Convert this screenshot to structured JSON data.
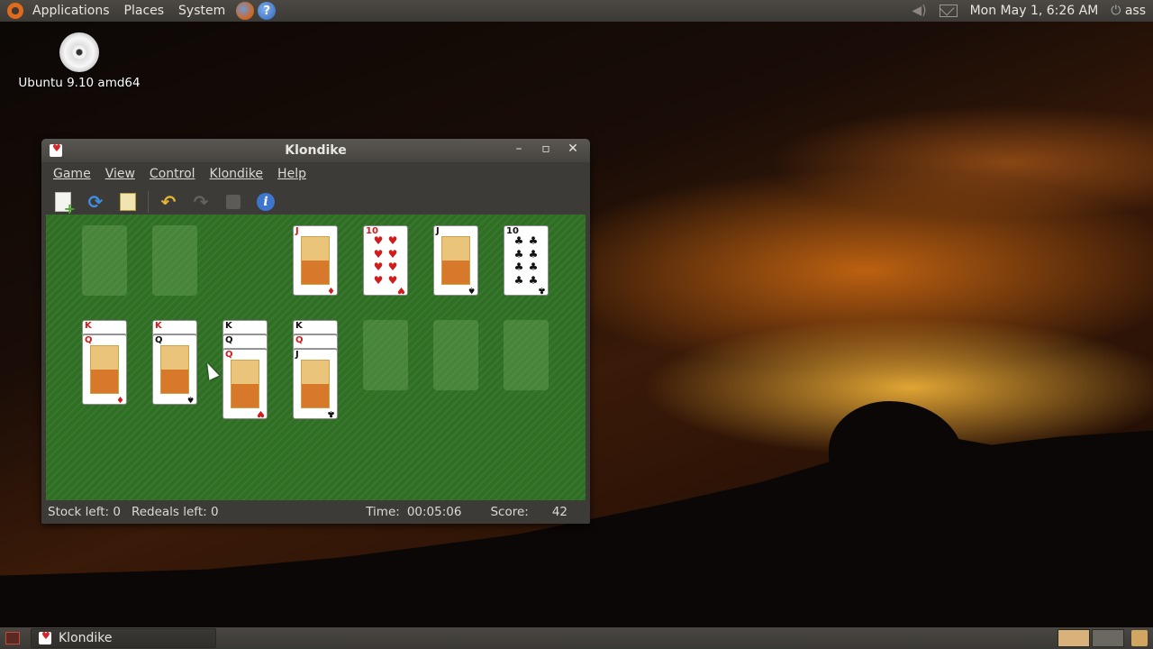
{
  "top_panel": {
    "menu": [
      "Applications",
      "Places",
      "System"
    ],
    "launchers": [
      "firefox-icon",
      "help-icon"
    ],
    "clock": "Mon May  1,  6:26 AM",
    "user": "ass"
  },
  "desktop": {
    "icons": [
      {
        "label": "Ubuntu 9.10 amd64",
        "icon": "cd-icon"
      }
    ]
  },
  "window": {
    "title": "Klondike",
    "menu": [
      {
        "label": "Game"
      },
      {
        "label": "View"
      },
      {
        "label": "Control"
      },
      {
        "label": "Klondike"
      },
      {
        "label": "Help"
      }
    ],
    "toolbar": [
      "new-game-icon",
      "restart-icon",
      "hint-icon",
      "undo-icon",
      "redo-icon",
      "deal-icon",
      "info-icon"
    ],
    "status": {
      "stock": "Stock left: 0",
      "redeals": "Redeals left: 0",
      "time_label": "Time:",
      "time_value": "00:05:06",
      "score_label": "Score:",
      "score_value": "42"
    }
  },
  "game": {
    "foundations": [
      {
        "rank": "J",
        "suit": "♦",
        "color": "red"
      },
      {
        "rank": "10",
        "suit": "♥",
        "color": "red"
      },
      {
        "rank": "J",
        "suit": "♠",
        "color": "black"
      },
      {
        "rank": "10",
        "suit": "♣",
        "color": "black"
      }
    ],
    "tableau": [
      [
        {
          "rank": "K",
          "suit": "♦",
          "color": "red"
        },
        {
          "rank": "Q",
          "suit": "♦",
          "color": "red"
        }
      ],
      [
        {
          "rank": "K",
          "suit": "♥",
          "color": "red"
        },
        {
          "rank": "Q",
          "suit": "♠",
          "color": "black"
        }
      ],
      [
        {
          "rank": "K",
          "suit": "♠",
          "color": "black"
        },
        {
          "rank": "Q",
          "suit": "♠",
          "color": "black"
        },
        {
          "rank": "Q",
          "suit": "♥",
          "color": "red"
        }
      ],
      [
        {
          "rank": "K",
          "suit": "♣",
          "color": "black"
        },
        {
          "rank": "Q",
          "suit": "♦",
          "color": "red"
        },
        {
          "rank": "J",
          "suit": "♣",
          "color": "black"
        }
      ]
    ]
  },
  "bottom_panel": {
    "task": "Klondike"
  }
}
